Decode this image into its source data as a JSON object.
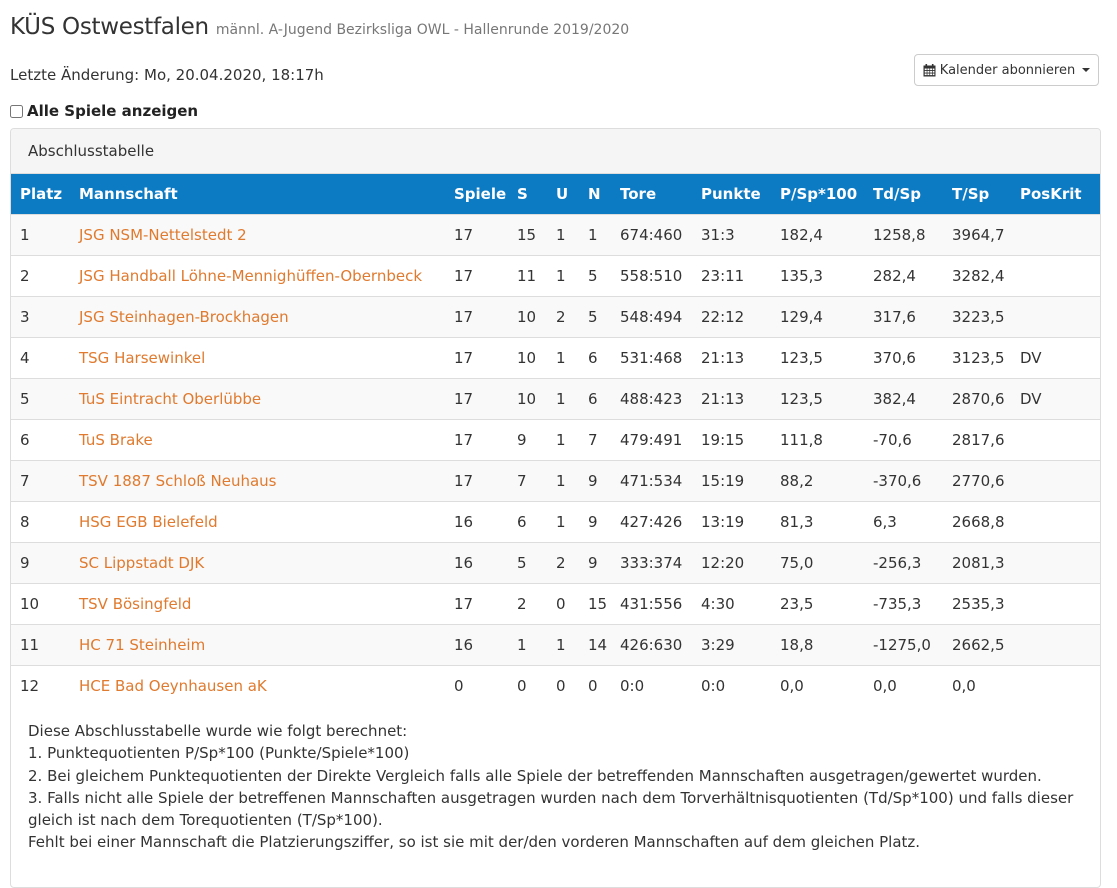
{
  "header": {
    "title": "KÜS Ostwestfalen",
    "subtitle": "männl. A-Jugend Bezirksliga OWL - Hallenrunde 2019/2020"
  },
  "updated": "Letzte Änderung: Mo, 20.04.2020, 18:17h",
  "calendar_button": {
    "label": "Kalender abonnieren",
    "icon": "calendar-icon"
  },
  "show_all": {
    "label": "Alle Spiele anzeigen",
    "checked": false
  },
  "panel": {
    "title": "Abschlusstabelle"
  },
  "table": {
    "columns": [
      "Platz",
      "Mannschaft",
      "Spiele",
      "S",
      "U",
      "N",
      "Tore",
      "Punkte",
      "P/Sp*100",
      "Td/Sp",
      "T/Sp",
      "PosKrit"
    ],
    "rows": [
      [
        "1",
        "JSG NSM-Nettelstedt 2",
        "17",
        "15",
        "1",
        "1",
        "674:460",
        "31:3",
        "182,4",
        "1258,8",
        "3964,7",
        ""
      ],
      [
        "2",
        "JSG Handball Löhne-Mennighüffen-Obernbeck",
        "17",
        "11",
        "1",
        "5",
        "558:510",
        "23:11",
        "135,3",
        "282,4",
        "3282,4",
        ""
      ],
      [
        "3",
        "JSG Steinhagen-Brockhagen",
        "17",
        "10",
        "2",
        "5",
        "548:494",
        "22:12",
        "129,4",
        "317,6",
        "3223,5",
        ""
      ],
      [
        "4",
        "TSG Harsewinkel",
        "17",
        "10",
        "1",
        "6",
        "531:468",
        "21:13",
        "123,5",
        "370,6",
        "3123,5",
        "DV"
      ],
      [
        "5",
        "TuS Eintracht Oberlübbe",
        "17",
        "10",
        "1",
        "6",
        "488:423",
        "21:13",
        "123,5",
        "382,4",
        "2870,6",
        "DV"
      ],
      [
        "6",
        "TuS Brake",
        "17",
        "9",
        "1",
        "7",
        "479:491",
        "19:15",
        "111,8",
        "-70,6",
        "2817,6",
        ""
      ],
      [
        "7",
        "TSV 1887 Schloß Neuhaus",
        "17",
        "7",
        "1",
        "9",
        "471:534",
        "15:19",
        "88,2",
        "-370,6",
        "2770,6",
        ""
      ],
      [
        "8",
        "HSG EGB Bielefeld",
        "16",
        "6",
        "1",
        "9",
        "427:426",
        "13:19",
        "81,3",
        "6,3",
        "2668,8",
        ""
      ],
      [
        "9",
        "SC Lippstadt DJK",
        "16",
        "5",
        "2",
        "9",
        "333:374",
        "12:20",
        "75,0",
        "-256,3",
        "2081,3",
        ""
      ],
      [
        "10",
        "TSV Bösingfeld",
        "17",
        "2",
        "0",
        "15",
        "431:556",
        "4:30",
        "23,5",
        "-735,3",
        "2535,3",
        ""
      ],
      [
        "11",
        "HC 71 Steinheim",
        "16",
        "1",
        "1",
        "14",
        "426:630",
        "3:29",
        "18,8",
        "-1275,0",
        "2662,5",
        ""
      ],
      [
        "12",
        "HCE Bad Oeynhausen aK",
        "0",
        "0",
        "0",
        "0",
        "0:0",
        "0:0",
        "0,0",
        "0,0",
        "0,0",
        ""
      ]
    ]
  },
  "notes": [
    "Diese Abschlusstabelle wurde wie folgt berechnet:",
    "1. Punktequotienten P/Sp*100 (Punkte/Spiele*100)",
    "2. Bei gleichem Punktequotienten der Direkte Vergleich falls alle Spiele der betreffenden Mannschaften ausgetragen/gewertet wurden.",
    "3. Falls nicht alle Spiele der betreffenen Mannschaften ausgetragen wurden nach dem Torverhältnisquotienten (Td/Sp*100) und falls dieser gleich ist nach dem Torequotienten (T/Sp*100).",
    "Fehlt bei einer Mannschaft die Platzierungsziffer, so ist sie mit der/den vorderen Mannschaften auf dem gleichen Platz."
  ]
}
